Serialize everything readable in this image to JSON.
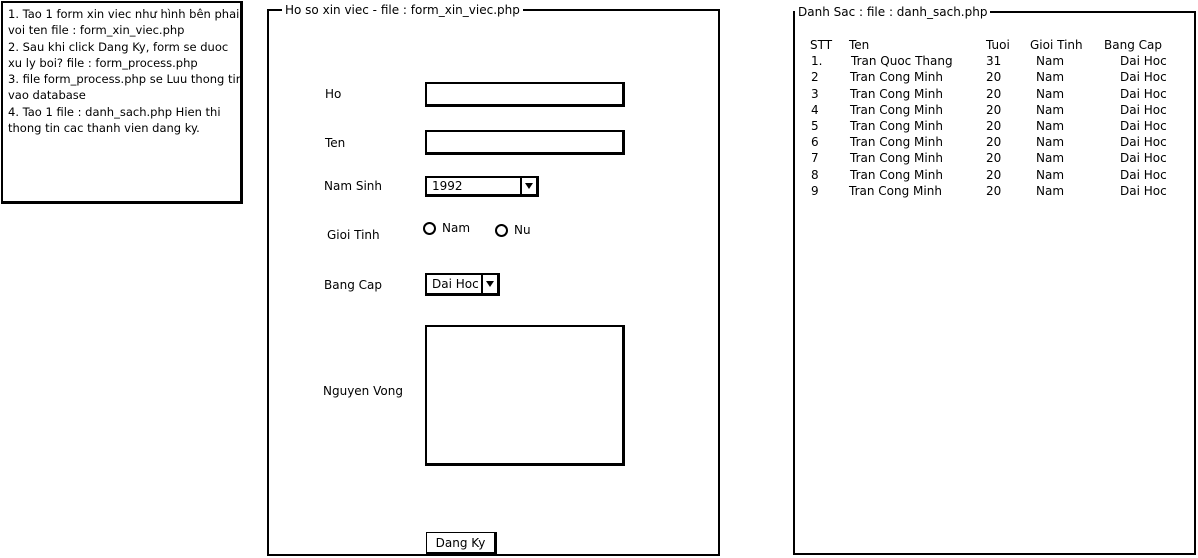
{
  "instructions": "1. Tao 1 form xin viec như hình bên phai voi ten file : form_xin_viec.php\n2. Sau khi click Dang Ky, form se duoc xu ly boi? file : form_process.php\n3. file form_process.php se Luu thong tin vao database\n4. Tao 1 file : danh_sach.php Hien thi thong tin cac thanh vien dang ky.",
  "form": {
    "title": "Ho so xin viec - file : form_xin_viec.php",
    "ho_label": "Ho",
    "ho_value": "",
    "ten_label": "Ten",
    "ten_value": "",
    "nam_sinh_label": "Nam Sinh",
    "nam_sinh_value": "1992",
    "gioi_tinh_label": "Gioi Tinh",
    "gioi_tinh_options": [
      "Nam",
      "Nu"
    ],
    "bang_cap_label": "Bang Cap",
    "bang_cap_value": "Dai Hoc",
    "nguyen_vong_label": "Nguyen Vong",
    "nguyen_vong_value": "",
    "submit_label": "Dang Ky"
  },
  "list": {
    "title": "Danh Sac : file : danh_sach.php",
    "columns": [
      "STT",
      "Ten",
      "Tuoi",
      "Gioi Tinh",
      "Bang Cap"
    ],
    "rows": [
      [
        "1.",
        "Tran Quoc Thang",
        "31",
        "Nam",
        "Dai Hoc"
      ],
      [
        "2",
        "Tran Cong Minh",
        "20",
        "Nam",
        "Dai Hoc"
      ],
      [
        "3",
        "Tran Cong Minh",
        "20",
        "Nam",
        "Dai Hoc"
      ],
      [
        "4",
        "Tran Cong Minh",
        "20",
        "Nam",
        "Dai Hoc"
      ],
      [
        "5",
        "Tran Cong Minh",
        "20",
        "Nam",
        "Dai Hoc"
      ],
      [
        "6",
        "Tran Cong Minh",
        "20",
        "Nam",
        "Dai Hoc"
      ],
      [
        "7",
        "Tran Cong Minh",
        "20",
        "Nam",
        "Dai Hoc"
      ],
      [
        "8",
        "Tran Cong Minh",
        "20",
        "Nam",
        "Dai Hoc"
      ],
      [
        "9",
        "Tran Cong Minh",
        "20",
        "Nam",
        "Dai Hoc"
      ]
    ]
  }
}
